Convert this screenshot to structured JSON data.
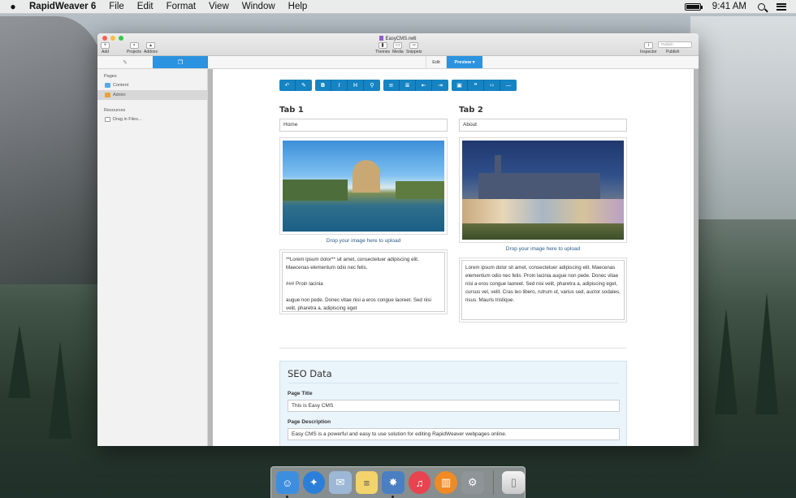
{
  "menubar": {
    "app_name": "RapidWeaver 6",
    "menus": [
      "File",
      "Edit",
      "Format",
      "View",
      "Window",
      "Help"
    ],
    "clock": "9:41 AM"
  },
  "window": {
    "title": "EasyCMS.rw6",
    "toolbar_left": [
      "Add",
      "Projects",
      "Addons"
    ],
    "toolbar_center": [
      "Themes",
      "Media",
      "Snippets"
    ],
    "toolbar_right": [
      "Inspector",
      "Publish"
    ],
    "publish_placeholder": "Publish"
  },
  "subbar": {
    "edit_label": "Edit",
    "preview_label": "Preview ▾"
  },
  "sidebar": {
    "pages_heading": "Pages",
    "pages": [
      {
        "label": "Content",
        "selected": false,
        "color": "#5aa9e6"
      },
      {
        "label": "Admin",
        "selected": true,
        "color": "#e6a23c"
      }
    ],
    "resources_heading": "Resources",
    "resources": [
      {
        "label": "Drag in Files..."
      }
    ]
  },
  "editor": {
    "toolbar_groups": [
      [
        {
          "icon": "undo-icon",
          "glyph": "↶"
        },
        {
          "icon": "eraser-icon",
          "glyph": "✎"
        }
      ],
      [
        {
          "icon": "bold-icon",
          "glyph": "B"
        },
        {
          "icon": "italic-icon",
          "glyph": "I"
        },
        {
          "icon": "heading-icon",
          "glyph": "H"
        },
        {
          "icon": "link-icon",
          "glyph": "⚲"
        }
      ],
      [
        {
          "icon": "bullet-list-icon",
          "glyph": "≡"
        },
        {
          "icon": "numbered-list-icon",
          "glyph": "≣"
        },
        {
          "icon": "outdent-icon",
          "glyph": "⇤"
        },
        {
          "icon": "indent-icon",
          "glyph": "⇥"
        }
      ],
      [
        {
          "icon": "image-icon",
          "glyph": "▣"
        },
        {
          "icon": "quote-icon",
          "glyph": "❝"
        },
        {
          "icon": "code-icon",
          "glyph": "‹›"
        },
        {
          "icon": "horizontal-rule-icon",
          "glyph": "—"
        }
      ]
    ],
    "tab1": {
      "title": "Tab 1",
      "field_value": "Home",
      "upload_text": "Drop your image here to upload",
      "text": "**Lorem ipsum dolor** sit amet, consectetuer adipiscing elit. Maecenas elementum odio nec felis.\n\n### Proin lacinia\n\naugue non pede. Donec vitae nisi a eros congue laoreet. Sed nisi velit, pharetra a, adipiscing eget"
    },
    "tab2": {
      "title": "Tab 2",
      "field_value": "About",
      "upload_text": "Drop your image here to upload",
      "text": "Lorem ipsum dolor sit amet, consectetuer adipiscing elit. Maecenas elementum odio nec felis. Proin lacinia augue non pede. Donec vitae nisi a eros congue laoreet. Sed nisi velit, pharetra a, adipiscing eget, cursus vel, velit. Cras leo libero, rutrum ut, varius sed, auctor sodales, risus. Mauris tristique."
    },
    "seo": {
      "heading": "SEO Data",
      "page_title_label": "Page Title",
      "page_title_value": "This is Easy CMS",
      "page_description_label": "Page Description",
      "page_description_value": "Easy CMS is a powerful and easy to use solution for editing RapidWeaver webpages online."
    }
  },
  "dock": {
    "apps": [
      {
        "icon": "finder-icon",
        "color": "#3e8ee0",
        "running": true
      },
      {
        "icon": "safari-icon",
        "color": "#2c7fd8",
        "running": false
      },
      {
        "icon": "mail-icon",
        "color": "#9db8d6",
        "running": false
      },
      {
        "icon": "notes-icon",
        "color": "#f3d36b",
        "running": false
      },
      {
        "icon": "rapidweaver-icon",
        "color": "#4a7fc1",
        "running": true
      },
      {
        "icon": "itunes-icon",
        "color": "#e8434f",
        "running": false
      },
      {
        "icon": "ibooks-icon",
        "color": "#f08a24",
        "running": false
      },
      {
        "icon": "system-preferences-icon",
        "color": "#8f9499",
        "running": false
      }
    ],
    "trash_icon": "trash-icon"
  }
}
